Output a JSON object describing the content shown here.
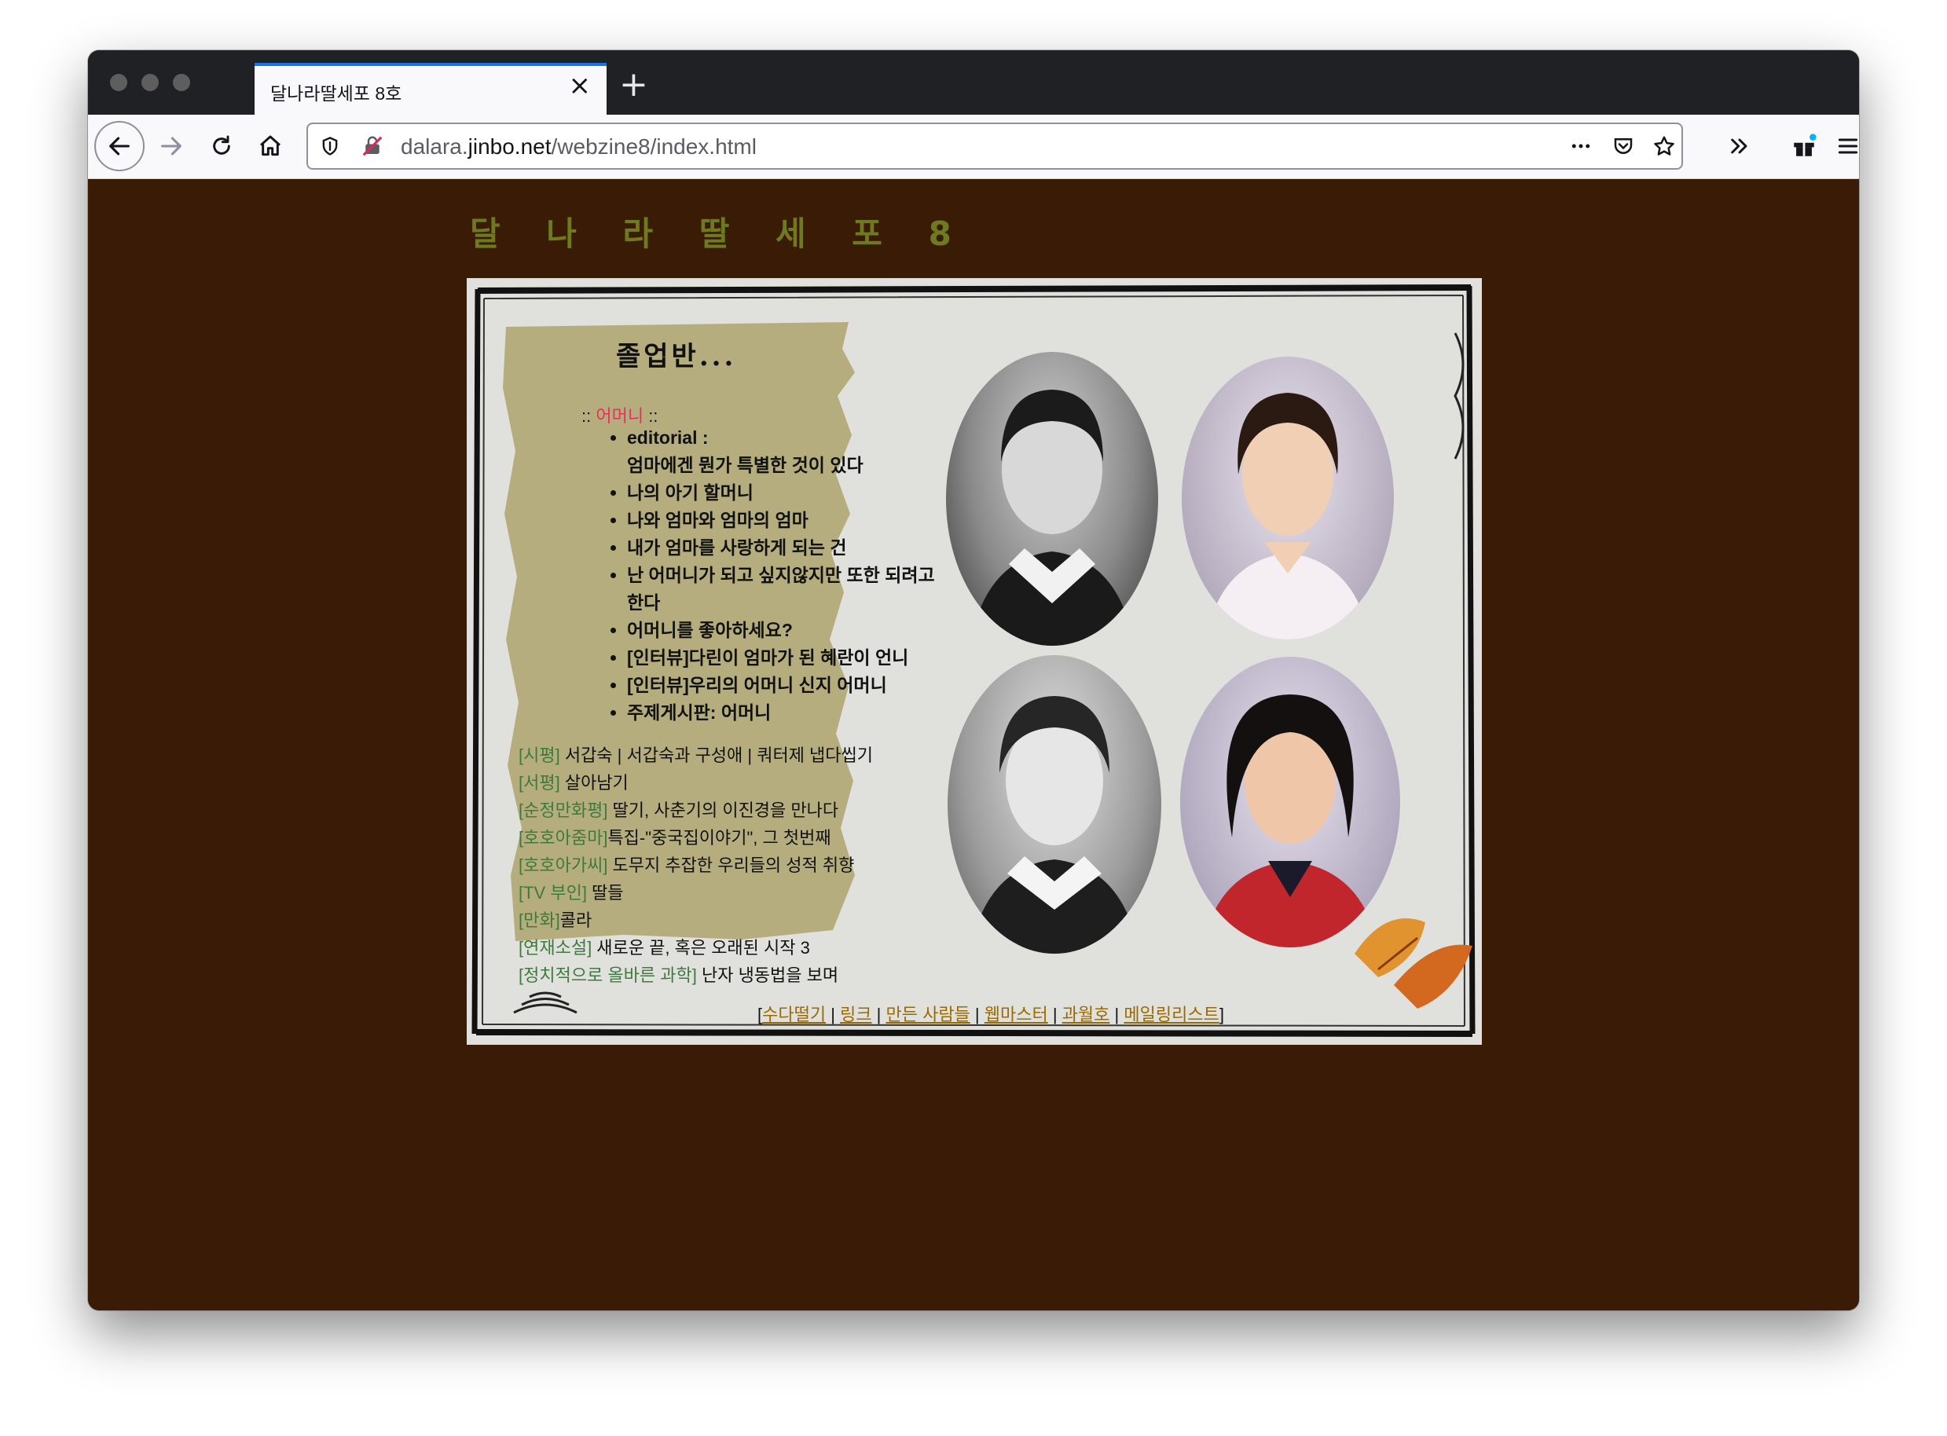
{
  "browser": {
    "tab_title": "달나라딸세포 8호",
    "url_host_prefix": "dalara.",
    "url_host_main": "jinbo.net",
    "url_path": "/webzine8/index.html"
  },
  "page": {
    "site_title": "달 나 라  딸 세 포  8",
    "section_title": "졸업반...",
    "topic_prefix": ":: ",
    "topic": "어머니",
    "topic_suffix": " ::",
    "items": [
      "editorial :",
      "엄마에겐 뭔가 특별한 것이 있다",
      "나의 아기 할머니",
      "나와 엄마와 엄마의 엄마",
      "내가 엄마를 사랑하게 되는 건",
      "난 어머니가 되고 싶지않지만 또한 되려고 한다",
      "어머니를 좋아하세요?",
      "[인터뷰]다린이 엄마가 된 혜란이 언니",
      "[인터뷰]우리의 어머니 신지 어머니",
      "주제게시판: 어머니"
    ],
    "reviews": [
      {
        "tag": "[시평]",
        "text": " 서갑숙 | 서갑숙과 구성애 | 쿼터제 냅다씹기"
      },
      {
        "tag": "[서평]",
        "text": " 살아남기"
      },
      {
        "tag": "[순정만화평]",
        "text": " 딸기, 사춘기의 이진경을 만나다"
      },
      {
        "tag": "[호호아줌마]",
        "text": "특집-\"중국집이야기\", 그 첫번째"
      },
      {
        "tag": "[호호아가씨]",
        "text": " 도무지 추잡한 우리들의 성적 취향"
      },
      {
        "tag": "[TV 부인]",
        "text": " 딸들"
      },
      {
        "tag": "[만화]",
        "text": "콜라"
      },
      {
        "tag": "[연재소설]",
        "text": " 새로운 끝, 혹은 오래된 시작 3"
      },
      {
        "tag": "[정치적으로 올바른 과학]",
        "text": " 난자 냉동법을 보며"
      }
    ],
    "footer": {
      "open": "[",
      "close": "]",
      "sep": " | ",
      "links": [
        "수다떨기",
        "링크",
        "만든 사람들",
        "웹마스터",
        "과월호",
        "메일링리스트"
      ]
    }
  },
  "colors": {
    "page_bg": "#3a1c06",
    "site_title": "#6e7a1e",
    "topic_highlight": "#e8305a",
    "review_tag": "#3f7a3d",
    "footer_link": "#9a6a00"
  },
  "icons": [
    "back-icon",
    "forward-icon",
    "reload-icon",
    "home-icon",
    "shield-icon",
    "insecure-lock-icon",
    "more-icon",
    "pocket-icon",
    "star-icon",
    "overflow-icon",
    "gift-icon",
    "menu-icon",
    "close-icon",
    "plus-icon"
  ]
}
